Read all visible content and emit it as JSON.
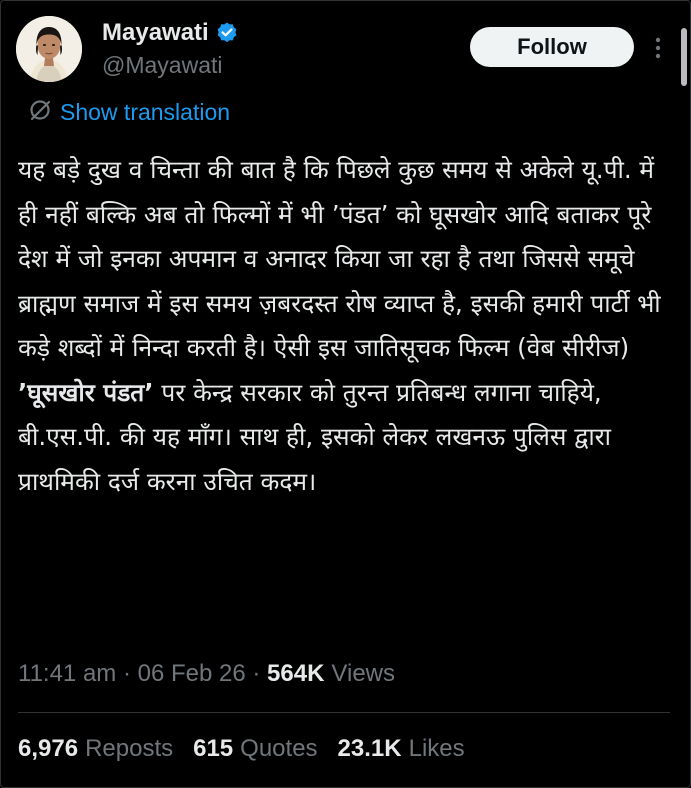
{
  "colors": {
    "background": "#000000",
    "text_primary": "#e7e9ea",
    "text_secondary": "#71767b",
    "accent": "#1d9bf0",
    "follow_button_bg": "#eff3f4"
  },
  "author": {
    "display_name": "Mayawati",
    "handle": "@Mayawati",
    "verified_icon": "verified-badge-icon"
  },
  "header": {
    "follow_label": "Follow",
    "more_icon": "more-vertical-icon"
  },
  "translation": {
    "icon": "translate-icon",
    "label": "Show translation"
  },
  "tweet": {
    "text_part1": "यह बड़े दुख व चिन्ता की बात है कि पिछले कुछ समय से अकेले यू.पी. में ही नहीं बल्कि अब तो फिल्मों में भी ’पंडत’ को घूसखोर आदि बताकर पूरे देश में जो इनका अपमान व अनादर किया जा रहा है तथा जिससे समूचे ब्राह्मण समाज में इस समय ज़बरदस्त रोष व्याप्त है, इसकी हमारी पार्टी भी कड़े शब्दों में निन्दा करती है। ऐसी इस जातिसूचक फिल्म (वेब सीरीज) ",
    "text_bold": "’घूसखोर पंडत’",
    "text_part2": " पर केन्द्र सरकार को तुरन्त प्रतिबन्ध लगाना चाहिये, बी.एस.पी. की यह माँग। साथ ही, इसको लेकर लखनऊ पुलिस द्वारा प्राथमिकी दर्ज करना उचित कदम।"
  },
  "meta": {
    "time": "11:41 am",
    "separator": " · ",
    "date": "06 Feb 26",
    "views_count": "564K",
    "views_label": "Views"
  },
  "stats": {
    "reposts_count": "6,976",
    "reposts_label": "Reposts",
    "quotes_count": "615",
    "quotes_label": "Quotes",
    "likes_count": "23.1K",
    "likes_label": "Likes"
  }
}
